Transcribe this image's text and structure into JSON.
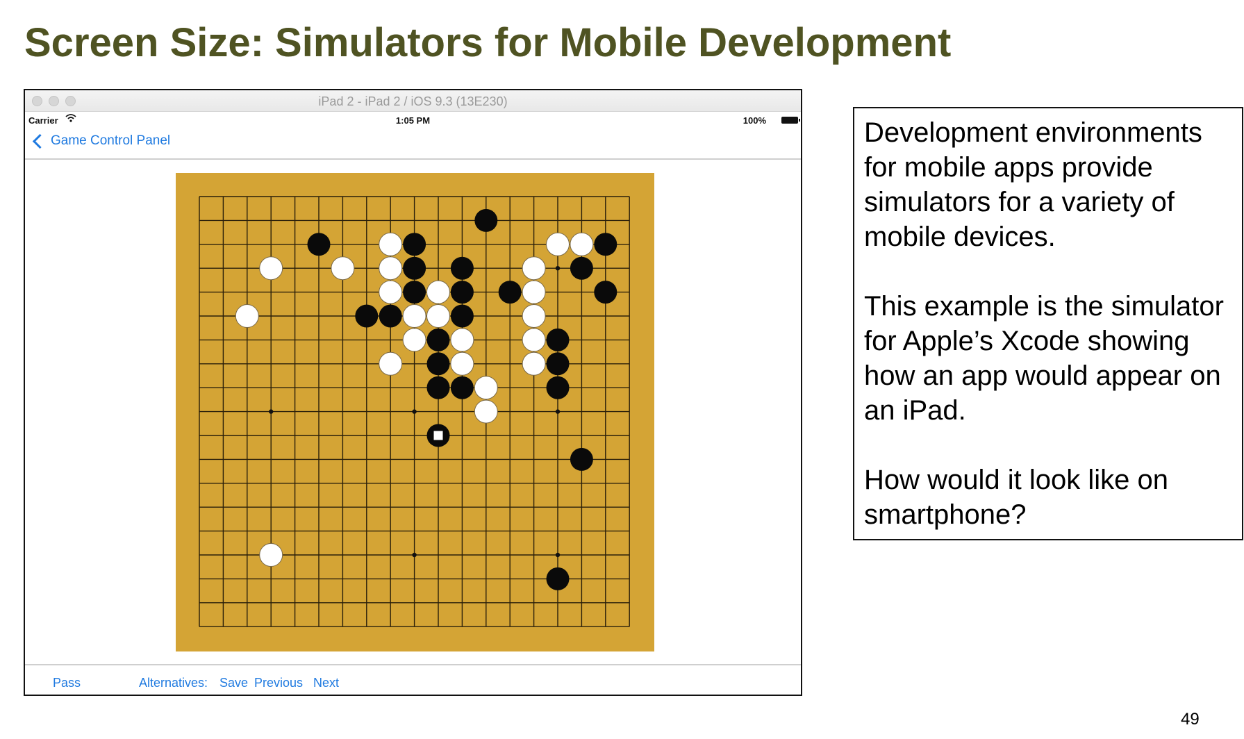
{
  "slide": {
    "title": "Screen Size: Simulators for Mobile Development",
    "page_number": "49",
    "paragraphs": [
      "Development environments for mobile apps provide simulators for a variety of mobile devices.",
      "This example is the simulator for Apple’s Xcode showing how an app would appear on an iPad.",
      "How would it look like on smartphone?"
    ]
  },
  "simulator": {
    "window_title": "iPad 2 - iPad 2 / iOS 9.3 (13E230)",
    "status": {
      "carrier": "Carrier",
      "wifi_icon": "wifi-icon",
      "time": "1:05 PM",
      "battery": "100%"
    },
    "nav": {
      "back_label": "Game Control Panel"
    },
    "toolbar": {
      "pass": "Pass",
      "alternatives": "Alternatives:",
      "save": "Save",
      "previous": "Previous",
      "next": "Next"
    },
    "colors": {
      "accent": "#1f7ae0",
      "board": "#d4a435",
      "title": "#4f5322"
    }
  },
  "go_board": {
    "size": 19,
    "star_points": [
      [
        3,
        3
      ],
      [
        9,
        3
      ],
      [
        15,
        3
      ],
      [
        3,
        9
      ],
      [
        9,
        9
      ],
      [
        15,
        9
      ],
      [
        3,
        15
      ],
      [
        9,
        15
      ],
      [
        15,
        15
      ]
    ],
    "black_stones": [
      [
        12,
        1
      ],
      [
        5,
        2
      ],
      [
        9,
        2
      ],
      [
        17,
        2
      ],
      [
        9,
        3
      ],
      [
        11,
        3
      ],
      [
        16,
        3
      ],
      [
        9,
        4
      ],
      [
        11,
        4
      ],
      [
        13,
        4
      ],
      [
        17,
        4
      ],
      [
        7,
        5
      ],
      [
        8,
        5
      ],
      [
        11,
        5
      ],
      [
        10,
        6
      ],
      [
        15,
        6
      ],
      [
        10,
        7
      ],
      [
        15,
        7
      ],
      [
        10,
        8
      ],
      [
        11,
        8
      ],
      [
        15,
        8
      ],
      [
        16,
        11
      ],
      [
        15,
        16
      ]
    ],
    "white_stones": [
      [
        8,
        2
      ],
      [
        15,
        2
      ],
      [
        16,
        2
      ],
      [
        3,
        3
      ],
      [
        6,
        3
      ],
      [
        8,
        3
      ],
      [
        14,
        3
      ],
      [
        8,
        4
      ],
      [
        10,
        4
      ],
      [
        14,
        4
      ],
      [
        2,
        5
      ],
      [
        9,
        5
      ],
      [
        10,
        5
      ],
      [
        14,
        5
      ],
      [
        9,
        6
      ],
      [
        11,
        6
      ],
      [
        14,
        6
      ],
      [
        8,
        7
      ],
      [
        11,
        7
      ],
      [
        14,
        7
      ],
      [
        12,
        8
      ],
      [
        12,
        9
      ],
      [
        3,
        15
      ]
    ],
    "last_move": [
      10,
      10
    ],
    "last_move_color": "black"
  }
}
